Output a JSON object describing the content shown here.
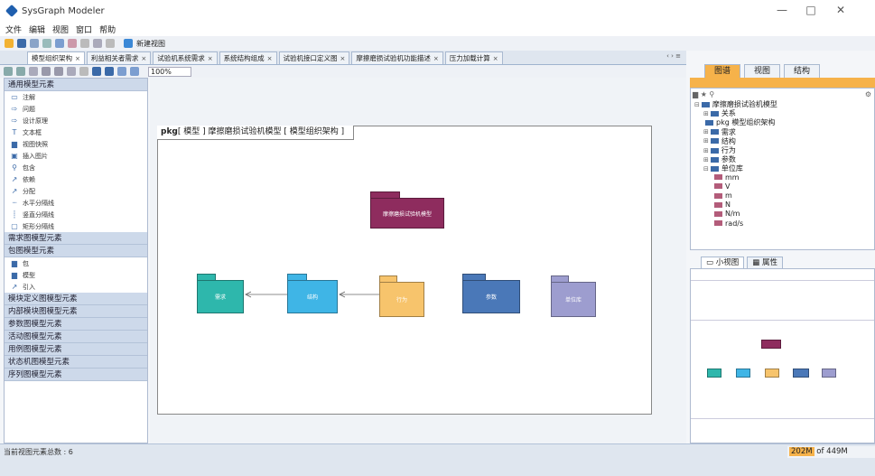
{
  "app": {
    "title": "SysGraph Modeler"
  },
  "window_buttons": {
    "minimize": "—",
    "maximize": "□",
    "close": "✕"
  },
  "menu": [
    "文件",
    "编辑",
    "视图",
    "窗口",
    "帮助"
  ],
  "toolbar": {
    "new_view_label": "新建视图"
  },
  "tabs": [
    {
      "label": "模型组织架构",
      "active": true
    },
    {
      "label": "利益相关者需求",
      "active": false
    },
    {
      "label": "试验机系统需求",
      "active": false
    },
    {
      "label": "系统结构组成",
      "active": false
    },
    {
      "label": "试验机接口定义图",
      "active": false
    },
    {
      "label": "摩擦磨损试验机功能描述",
      "active": false
    },
    {
      "label": "压力加载计算",
      "active": false
    }
  ],
  "tab_nav": "‹ › ≡",
  "zoom": "100%",
  "palette": {
    "general_header": "通用模型元素",
    "general_items": [
      {
        "icon": "comment-icon",
        "glyph": "▭",
        "label": "注解"
      },
      {
        "icon": "problem-icon",
        "glyph": "⇨",
        "label": "问题"
      },
      {
        "icon": "rationale-icon",
        "glyph": "⇨",
        "label": "设计原理"
      },
      {
        "icon": "text-icon",
        "glyph": "T",
        "label": "文本框"
      },
      {
        "icon": "view-snapshot-icon",
        "glyph": "▆",
        "label": "视图快照"
      },
      {
        "icon": "insert-image-icon",
        "glyph": "▣",
        "label": "插入图片"
      },
      {
        "icon": "contain-icon",
        "glyph": "⚲",
        "label": "包含"
      },
      {
        "icon": "dependency-icon",
        "glyph": "↗",
        "label": "依赖"
      },
      {
        "icon": "allocate-icon",
        "glyph": "↗",
        "label": "分配"
      },
      {
        "icon": "h-separator-icon",
        "glyph": "┈",
        "label": "水平分隔线"
      },
      {
        "icon": "v-separator-icon",
        "glyph": "┊",
        "label": "竖直分隔线"
      },
      {
        "icon": "rect-separator-icon",
        "glyph": "▢",
        "label": "矩形分隔线"
      }
    ],
    "req_header": "需求图模型元素",
    "pkg_header": "包图模型元素",
    "pkg_items": [
      {
        "icon": "package-icon",
        "glyph": "▆",
        "label": "包"
      },
      {
        "icon": "model-icon",
        "glyph": "▆",
        "label": "模型"
      },
      {
        "icon": "import-icon",
        "glyph": "↗",
        "label": "引入"
      }
    ],
    "other_headers": [
      "模块定义图模型元素",
      "内部模块图模型元素",
      "参数图模型元素",
      "活动图模型元素",
      "用例图模型元素",
      "状态机图模型元素",
      "序列图模型元素"
    ]
  },
  "diagram": {
    "frame_kind": "pkg",
    "frame_title": "[ 模型 ] 摩擦磨损试验机模型 [ 模型组织架构 ]",
    "packages": [
      {
        "label": "摩擦磨损试验机模型",
        "color": "#8e2c5e"
      },
      {
        "label": "需求",
        "color": "#2eb7ac"
      },
      {
        "label": "结构",
        "color": "#3fb5e6"
      },
      {
        "label": "行为",
        "color": "#f7c46c"
      },
      {
        "label": "参数",
        "color": "#4a78b8"
      },
      {
        "label": "单位库",
        "color": "#9d9dcf"
      }
    ]
  },
  "status": {
    "text": "当前视图元素总数 : 6",
    "mem_used": "202M",
    "mem_total": "of 449M"
  },
  "right_panel": {
    "tabs": [
      {
        "label": "图谱",
        "active": true
      },
      {
        "label": "视图",
        "active": false
      },
      {
        "label": "结构",
        "active": false
      }
    ],
    "tree": [
      {
        "text": "摩擦磨损试验机模型",
        "level": 0,
        "exp": "⊟"
      },
      {
        "text": "关系",
        "level": 1,
        "exp": "⊞"
      },
      {
        "text": "pkg 模型组织架构",
        "level": 1,
        "exp": ""
      },
      {
        "text": "需求",
        "level": 1,
        "exp": "⊞"
      },
      {
        "text": "结构",
        "level": 1,
        "exp": "⊞"
      },
      {
        "text": "行为",
        "level": 1,
        "exp": "⊞"
      },
      {
        "text": "参数",
        "level": 1,
        "exp": "⊞"
      },
      {
        "text": "单位库",
        "level": 1,
        "exp": "⊟"
      },
      {
        "text": "mm",
        "level": 2,
        "exp": ""
      },
      {
        "text": "V",
        "level": 2,
        "exp": ""
      },
      {
        "text": "m",
        "level": 2,
        "exp": ""
      },
      {
        "text": "N",
        "level": 2,
        "exp": ""
      },
      {
        "text": "N/m",
        "level": 2,
        "exp": ""
      },
      {
        "text": "rad/s",
        "level": 2,
        "exp": ""
      }
    ],
    "bottom_tabs": [
      {
        "label": "小视图",
        "active": true
      },
      {
        "label": "属性",
        "active": false
      }
    ]
  }
}
